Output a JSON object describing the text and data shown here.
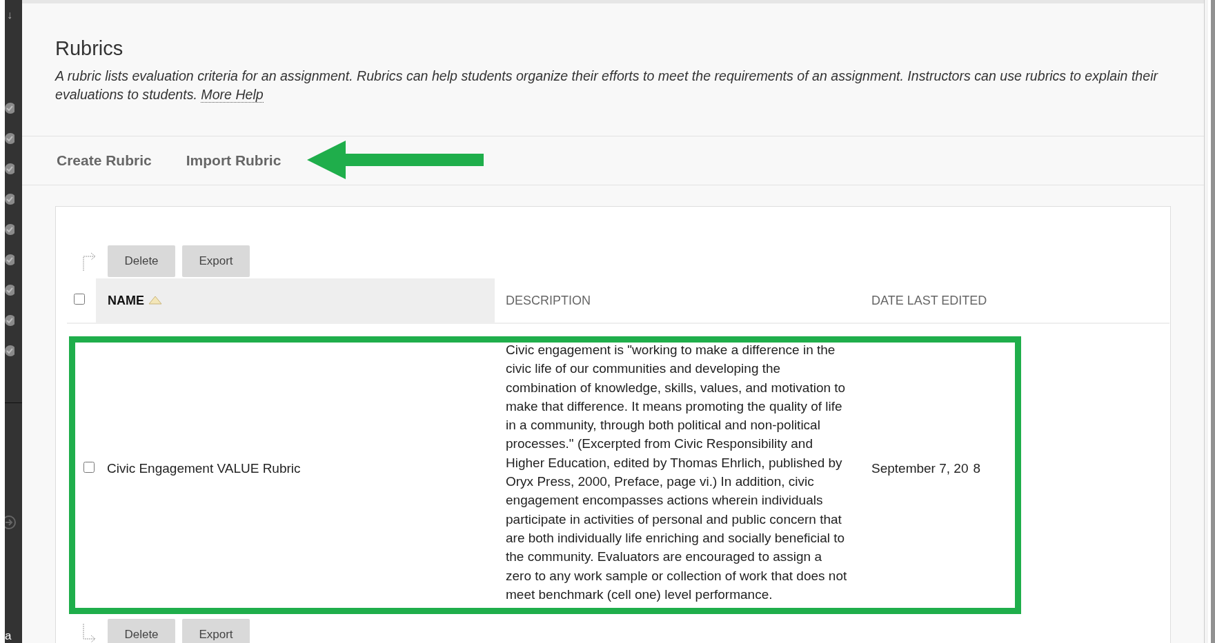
{
  "sidebar": {
    "top_glyph": "↓",
    "bottom_text": "a",
    "items": [
      {
        "kind": "check"
      },
      {
        "kind": "check"
      },
      {
        "kind": "check"
      },
      {
        "kind": "check"
      },
      {
        "kind": "check"
      },
      {
        "kind": "check"
      },
      {
        "kind": "check"
      },
      {
        "kind": "check"
      },
      {
        "kind": "check"
      },
      {
        "kind": "divider"
      },
      {
        "kind": "go"
      }
    ]
  },
  "page": {
    "title": "Rubrics",
    "description": "A rubric lists evaluation criteria for an assignment. Rubrics can help students organize their efforts to meet the requirements of an assignment. Instructors can use rubrics to explain their evaluations to students.",
    "help_link": "More Help"
  },
  "action_bar": [
    "Create Rubric",
    "Import Rubric"
  ],
  "table": {
    "top_buttons": [
      "Delete",
      "Export"
    ],
    "bottom_buttons": [
      "Delete",
      "Export"
    ],
    "select_all": {
      "checked": false
    },
    "columns": [
      {
        "label": "NAME",
        "sorted": true
      },
      {
        "label": "DESCRIPTION",
        "sorted": false
      },
      {
        "label": "DATE LAST EDITED",
        "sorted": false
      }
    ],
    "rows": [
      {
        "checked": false,
        "name": "Civic Engagement VALUE Rubric",
        "description": "Civic engagement is \"working to make a difference in the civic life of our communities and developing the combination of knowledge, skills, values, and motivation to make that difference. It means promoting the quality of life in a community, through both political and non-political processes.\" (Excerpted from Civic Responsibility and Higher Education, edited by Thomas Ehrlich, published by Oryx Press, 2000, Preface, page vi.) In addition, civic engagement encompasses actions wherein individuals participate in activities of personal and public concern that are both individually life enriching and socially beneficial to the community. Evaluators are encouraged to assign a zero to any work sample or collection of work that does not meet benchmark (cell one) level performance.",
        "date_parts": [
          "September 7, 20",
          "8"
        ]
      }
    ]
  }
}
